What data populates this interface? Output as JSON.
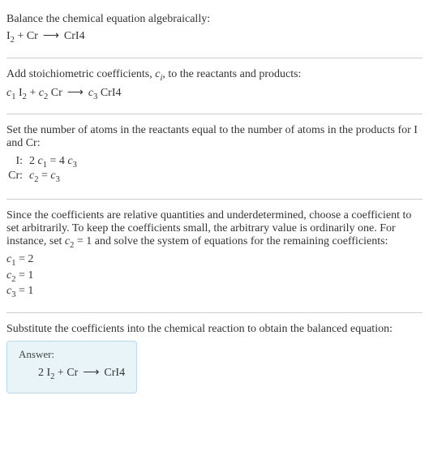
{
  "step1": {
    "intro": "Balance the chemical equation algebraically:",
    "eq_lhs1": "I",
    "eq_lhs1_sub": "2",
    "plus": " + ",
    "eq_lhs2": "Cr",
    "arrow": "⟶",
    "eq_rhs": "CrI4"
  },
  "step2": {
    "intro_a": "Add stoichiometric coefficients, ",
    "ci_c": "c",
    "ci_i": "i",
    "intro_b": ", to the reactants and products:",
    "c1": "c",
    "c1s": "1",
    "sp": " ",
    "i": "I",
    "i2": "2",
    "plus": " + ",
    "c2": "c",
    "c2s": "2",
    "cr": "Cr",
    "arrow": "⟶",
    "c3": "c",
    "c3s": "3",
    "cri4": "CrI4"
  },
  "step3": {
    "intro": "Set the number of atoms in the reactants equal to the number of atoms in the products for I and Cr:",
    "row1_label": "I:",
    "row1_eq_a": "2 ",
    "row1_eq_c1": "c",
    "row1_eq_c1s": "1",
    "row1_eq_mid": " = 4 ",
    "row1_eq_c3": "c",
    "row1_eq_c3s": "3",
    "row2_label": "Cr:",
    "row2_eq_c2": "c",
    "row2_eq_c2s": "2",
    "row2_eq_mid": " = ",
    "row2_eq_c3": "c",
    "row2_eq_c3s": "3"
  },
  "step4": {
    "intro_a": "Since the coefficients are relative quantities and underdetermined, choose a coefficient to set arbitrarily. To keep the coefficients small, the arbitrary value is ordinarily one. For instance, set ",
    "c2": "c",
    "c2s": "2",
    "intro_b": " = 1 and solve the system of equations for the remaining coefficients:",
    "l1_c": "c",
    "l1_s": "1",
    "l1_v": " = 2",
    "l2_c": "c",
    "l2_s": "2",
    "l2_v": " = 1",
    "l3_c": "c",
    "l3_s": "3",
    "l3_v": " = 1"
  },
  "step5": {
    "intro": "Substitute the coefficients into the chemical reaction to obtain the balanced equation:",
    "answer_label": "Answer:",
    "two": "2 ",
    "i": "I",
    "i2": "2",
    "plus": " + ",
    "cr": "Cr",
    "arrow": "⟶",
    "cri4": "CrI4"
  },
  "chart_data": {
    "type": "table",
    "title": "Balancing I2 + Cr -> CrI4",
    "unbalanced_equation": "I2 + Cr -> CrI4",
    "elements": [
      "I",
      "Cr"
    ],
    "atom_balance": [
      {
        "element": "I",
        "equation": "2 c1 = 4 c3"
      },
      {
        "element": "Cr",
        "equation": "c2 = c3"
      }
    ],
    "arbitrary": {
      "coefficient": "c2",
      "value": 1
    },
    "solution": {
      "c1": 2,
      "c2": 1,
      "c3": 1
    },
    "balanced_equation": "2 I2 + Cr -> CrI4"
  }
}
